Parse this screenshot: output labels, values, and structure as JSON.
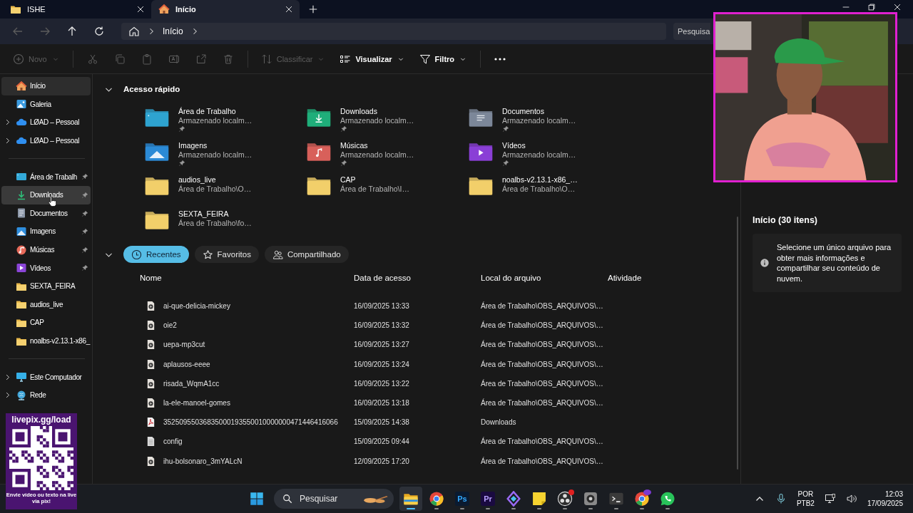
{
  "tabs": [
    {
      "label": "ISHE",
      "kind": "folder",
      "selected": false
    },
    {
      "label": "Início",
      "kind": "home",
      "selected": true
    }
  ],
  "address": {
    "crumbs": [
      "Início"
    ],
    "search_placeholder": "Pesquisa"
  },
  "toolbar": [
    {
      "kind": "new",
      "label": "Novo",
      "disabled": true
    },
    {
      "kind": "separator"
    },
    {
      "kind": "cut",
      "disabled": true
    },
    {
      "kind": "copy",
      "disabled": true
    },
    {
      "kind": "paste",
      "disabled": true
    },
    {
      "kind": "rename",
      "disabled": true
    },
    {
      "kind": "share",
      "disabled": true
    },
    {
      "kind": "delete",
      "disabled": true
    },
    {
      "kind": "separator"
    },
    {
      "kind": "sort",
      "label": "Classificar",
      "disabled": true
    },
    {
      "kind": "view",
      "label": "Visualizar",
      "disabled": false
    },
    {
      "kind": "filter",
      "label": "Filtro",
      "disabled": false
    },
    {
      "kind": "separator"
    },
    {
      "kind": "more",
      "disabled": false
    }
  ],
  "sidebar": {
    "sections": [
      {
        "items": [
          {
            "label": "Início",
            "kind": "home",
            "expandable": false,
            "pinned": false,
            "selected": true,
            "hovered": false
          },
          {
            "label": "Galeria",
            "kind": "gallery",
            "expandable": false,
            "pinned": false,
            "selected": false,
            "hovered": false
          },
          {
            "label": "LØAD – Pessoal",
            "kind": "cloud",
            "expandable": true,
            "pinned": false,
            "selected": false,
            "hovered": false
          },
          {
            "label": "LØAD – Pessoal",
            "kind": "cloud",
            "expandable": true,
            "pinned": false,
            "selected": false,
            "hovered": false
          }
        ]
      },
      {
        "items": [
          {
            "label": "Área de Trabalh",
            "kind": "desktop",
            "expandable": false,
            "pinned": true,
            "selected": false,
            "hovered": false
          },
          {
            "label": "Downloads",
            "kind": "download",
            "expandable": false,
            "pinned": true,
            "selected": false,
            "hovered": true
          },
          {
            "label": "Documentos",
            "kind": "documents",
            "expandable": false,
            "pinned": true,
            "selected": false,
            "hovered": false
          },
          {
            "label": "Imagens",
            "kind": "images",
            "expandable": false,
            "pinned": true,
            "selected": false,
            "hovered": false
          },
          {
            "label": "Músicas",
            "kind": "music",
            "expandable": false,
            "pinned": true,
            "selected": false,
            "hovered": false
          },
          {
            "label": "Vídeos",
            "kind": "videos",
            "expandable": false,
            "pinned": true,
            "selected": false,
            "hovered": false
          },
          {
            "label": "SEXTA_FEIRA",
            "kind": "folder",
            "expandable": false,
            "pinned": false,
            "selected": false,
            "hovered": false
          },
          {
            "label": "audios_live",
            "kind": "folder",
            "expandable": false,
            "pinned": false,
            "selected": false,
            "hovered": false
          },
          {
            "label": "CAP",
            "kind": "folder",
            "expandable": false,
            "pinned": false,
            "selected": false,
            "hovered": false
          },
          {
            "label": "noalbs-v2.13.1-x86_",
            "kind": "folder",
            "expandable": false,
            "pinned": false,
            "selected": false,
            "hovered": false
          }
        ]
      },
      {
        "items": [
          {
            "label": "Este Computador",
            "kind": "computer",
            "expandable": true,
            "pinned": false,
            "selected": false,
            "hovered": false
          },
          {
            "label": "Rede",
            "kind": "network",
            "expandable": true,
            "pinned": false,
            "selected": false,
            "hovered": false
          }
        ]
      }
    ]
  },
  "quick_access": {
    "title": "Acesso rápido",
    "expanded": true,
    "items": [
      {
        "name": "Área de Trabalho",
        "location": "Armazenado localm…",
        "kind": "desktop",
        "pinned": true
      },
      {
        "name": "Downloads",
        "location": "Armazenado localm…",
        "kind": "download",
        "pinned": true
      },
      {
        "name": "Documentos",
        "location": "Armazenado localm…",
        "kind": "documents",
        "pinned": true
      },
      {
        "name": "Imagens",
        "location": "Armazenado localm…",
        "kind": "images",
        "pinned": true
      },
      {
        "name": "Músicas",
        "location": "Armazenado localm…",
        "kind": "music",
        "pinned": true
      },
      {
        "name": "Vídeos",
        "location": "Armazenado localm…",
        "kind": "videos",
        "pinned": true
      },
      {
        "name": "audios_live",
        "location": "Área de Trabalho\\O…",
        "kind": "folder",
        "pinned": false
      },
      {
        "name": "CAP",
        "location": "Área de Trabalho\\I…",
        "kind": "folder",
        "pinned": false
      },
      {
        "name": "noalbs-v2.13.1-x86_…",
        "location": "Área de Trabalho\\O…",
        "kind": "folder",
        "pinned": false
      },
      {
        "name": "SEXTA_FEIRA",
        "location": "Área de Trabalho\\fo…",
        "kind": "folder",
        "pinned": false
      }
    ]
  },
  "recent": {
    "expanded": true,
    "filters": [
      {
        "label": "Recentes",
        "kind": "recent",
        "selected": true
      },
      {
        "label": "Favoritos",
        "kind": "favorites",
        "selected": false
      },
      {
        "label": "Compartilhado",
        "kind": "shared",
        "selected": false
      }
    ],
    "columns": [
      "Nome",
      "Data de acesso",
      "Local do arquivo",
      "Atividade"
    ],
    "rows": [
      {
        "name": "ai-que-delicia-mickey",
        "date": "16/09/2025 13:33",
        "location": "Área de Trabalho\\OBS_ARQUIVOS\\…",
        "kind": "audio"
      },
      {
        "name": "oie2",
        "date": "16/09/2025 13:32",
        "location": "Área de Trabalho\\OBS_ARQUIVOS\\…",
        "kind": "audio"
      },
      {
        "name": "uepa-mp3cut",
        "date": "16/09/2025 13:27",
        "location": "Área de Trabalho\\OBS_ARQUIVOS\\…",
        "kind": "audio"
      },
      {
        "name": "aplausos-eeee",
        "date": "16/09/2025 13:24",
        "location": "Área de Trabalho\\OBS_ARQUIVOS\\…",
        "kind": "audio"
      },
      {
        "name": "risada_WqmA1cc",
        "date": "16/09/2025 13:22",
        "location": "Área de Trabalho\\OBS_ARQUIVOS\\…",
        "kind": "audio"
      },
      {
        "name": "la-ele-manoel-gomes",
        "date": "16/09/2025 13:18",
        "location": "Área de Trabalho\\OBS_ARQUIVOS\\…",
        "kind": "audio"
      },
      {
        "name": "35250955036835000193550010000000471446416066",
        "date": "15/09/2025 14:38",
        "location": "Downloads",
        "kind": "pdf"
      },
      {
        "name": "config",
        "date": "15/09/2025 09:44",
        "location": "Área de Trabalho\\OBS_ARQUIVOS\\…",
        "kind": "text"
      },
      {
        "name": "ihu-bolsonaro_3mYALcN",
        "date": "12/09/2025 17:20",
        "location": "Área de Trabalho\\OBS_ARQUIVOS\\…",
        "kind": "audio"
      }
    ]
  },
  "details": {
    "title": "Início (30 itens)",
    "message": "Selecione um único arquivo para obter mais informações e compartilhar seu conteúdo de nuvem."
  },
  "qr_overlay": {
    "header": "livepix.gg/load",
    "footer": "Envie vídeo ou texto na live via pix!"
  },
  "taskbar": {
    "search_placeholder": "Pesquisar",
    "apps": [
      {
        "kind": "explorer",
        "active": true,
        "badge": false
      },
      {
        "kind": "chrome",
        "active": false,
        "badge": false
      },
      {
        "kind": "photoshop",
        "label": "Ps",
        "active": false,
        "badge": false
      },
      {
        "kind": "premiere",
        "label": "Pr",
        "active": false,
        "badge": false
      },
      {
        "kind": "diamond",
        "active": false,
        "badge": false
      },
      {
        "kind": "notes",
        "active": false,
        "badge": false
      },
      {
        "kind": "obs",
        "active": false,
        "badge": true
      },
      {
        "kind": "camera",
        "active": false,
        "badge": false
      },
      {
        "kind": "terminal",
        "active": false,
        "badge": false
      },
      {
        "kind": "chrome",
        "active": false,
        "badge": true
      },
      {
        "kind": "whatsapp",
        "active": false,
        "badge": false
      }
    ],
    "language": [
      "POR",
      "PTB2"
    ],
    "time": "12:03",
    "date": "17/09/2025"
  }
}
